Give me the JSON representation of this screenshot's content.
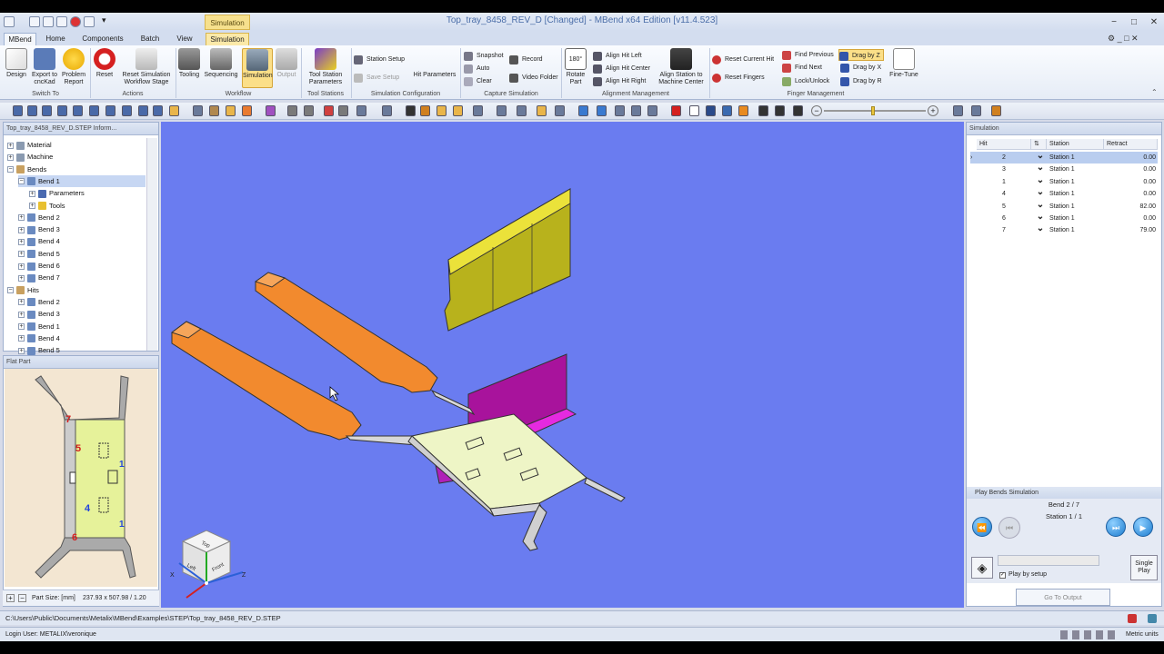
{
  "window": {
    "title": "Top_tray_8458_REV_D [Changed] - MBend x64 Edition [v11.4.523]",
    "context_tab": "Simulation"
  },
  "tabs": [
    {
      "label": "MBend"
    },
    {
      "label": "Home"
    },
    {
      "label": "Components"
    },
    {
      "label": "Batch"
    },
    {
      "label": "View"
    },
    {
      "label": "Simulation"
    }
  ],
  "ribbon": {
    "design": "Design",
    "export": "Export to cncKad",
    "problem": "Problem Report",
    "grp_switch": "Switch To",
    "reset": "Reset",
    "reset_sim": "Reset Simulation Workflow Stage",
    "grp_actions": "Actions",
    "tooling": "Tooling",
    "sequencing": "Sequencing",
    "simulation": "Simulation",
    "output": "Output",
    "grp_workflow": "Workflow",
    "tool_station": "Tool Station Parameters",
    "grp_tool_stations": "Tool Stations",
    "station_setup": "Station Setup",
    "save_setup": "Save Setup",
    "hit_params": "Hit Parameters",
    "grp_sim_config": "Simulation Configuration",
    "snapshot": "Snapshot",
    "record": "Record",
    "auto": "Auto",
    "video_folder": "Video Folder",
    "clear": "Clear",
    "grp_capture": "Capture Simulation",
    "rotate_part": "Rotate Part",
    "align_left": "Align Hit Left",
    "align_center": "Align Hit Center",
    "align_right": "Align Hit Right",
    "align_station": "Align Station to Machine Center",
    "grp_alignment": "Alignment Management",
    "reset_hit": "Reset Current Hit",
    "reset_fingers": "Reset Fingers",
    "find_prev": "Find Previous",
    "find_next": "Find Next",
    "lock_unlock": "Lock/Unlock",
    "drag_z": "Drag by Z",
    "drag_x": "Drag by X",
    "drag_r": "Drag by R",
    "fine_tune": "Fine-Tune",
    "grp_finger": "Finger Management"
  },
  "left_panel": {
    "title": "Top_tray_8458_REV_D.STEP Inform...",
    "tree": [
      {
        "label": "Material",
        "indent": 0
      },
      {
        "label": "Machine",
        "indent": 0
      },
      {
        "label": "Bends",
        "indent": 0
      },
      {
        "label": "Bend 1",
        "indent": 1,
        "selected": true
      },
      {
        "label": "Parameters",
        "indent": 2
      },
      {
        "label": "Tools",
        "indent": 2
      },
      {
        "label": "Bend 2",
        "indent": 1
      },
      {
        "label": "Bend 3",
        "indent": 1
      },
      {
        "label": "Bend 4",
        "indent": 1
      },
      {
        "label": "Bend 5",
        "indent": 1
      },
      {
        "label": "Bend 6",
        "indent": 1
      },
      {
        "label": "Bend 7",
        "indent": 1
      },
      {
        "label": "Hits",
        "indent": 0
      },
      {
        "label": "Bend 2",
        "indent": 1
      },
      {
        "label": "Bend 3",
        "indent": 1
      },
      {
        "label": "Bend 1",
        "indent": 1
      },
      {
        "label": "Bend 4",
        "indent": 1
      },
      {
        "label": "Bend 5",
        "indent": 1
      }
    ]
  },
  "flat_part": {
    "title": "Flat Part",
    "part_size_label": "Part Size: [mm]",
    "part_size_value": "237.93 x 507.98 / 1.20",
    "labels": {
      "n7": "7",
      "n5": "5",
      "n4": "4",
      "n6": "6",
      "n1a": "1",
      "n1b": "1"
    }
  },
  "viewcube": {
    "top": "Top",
    "left": "Left",
    "front": "Front",
    "axis_x": "X",
    "axis_z": "Z"
  },
  "simulation_panel": {
    "title": "Simulation",
    "headers": {
      "hit": "Hit",
      "station": "Station",
      "retract": "Retract"
    },
    "rows": [
      {
        "hit": "2",
        "station": "Station 1",
        "retract": "0.00",
        "selected": true
      },
      {
        "hit": "3",
        "station": "Station 1",
        "retract": "0.00"
      },
      {
        "hit": "1",
        "station": "Station 1",
        "retract": "0.00"
      },
      {
        "hit": "4",
        "station": "Station 1",
        "retract": "0.00"
      },
      {
        "hit": "5",
        "station": "Station 1",
        "retract": "82.00"
      },
      {
        "hit": "6",
        "station": "Station 1",
        "retract": "0.00"
      },
      {
        "hit": "7",
        "station": "Station 1",
        "retract": "79.00"
      }
    ],
    "play_title": "Play Bends Simulation",
    "bend_status": "Bend 2 / 7",
    "station_status": "Station 1 / 1",
    "play_by_setup": "Play by setup",
    "single_play": "Single Play",
    "go_to_output": "Go To Output"
  },
  "status": {
    "path": "C:\\Users\\Public\\Documents\\Metalix\\MBend\\Examples\\STEP\\Top_tray_8458_REV_D.STEP",
    "login": "Login User: METALIX\\veronique",
    "units": "Metric units"
  },
  "colors": {
    "viewport": "#6a7cf0",
    "punch": "#d8d028",
    "fingers": "#f28a2e",
    "die": "#a8139c",
    "sheet": "#eef5c6"
  }
}
